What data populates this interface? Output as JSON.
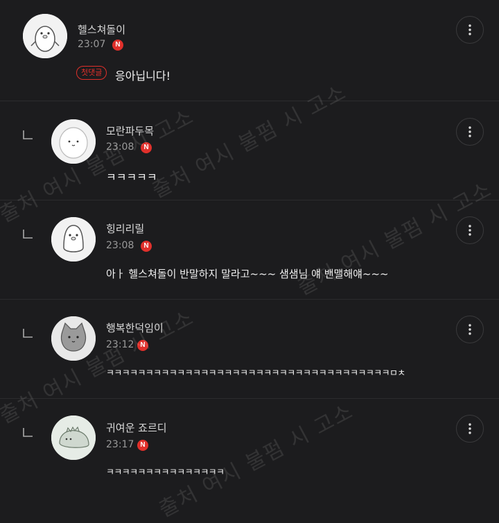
{
  "comments": [
    {
      "author": "헬스쳐돌이",
      "time": "23:07",
      "badge": "N",
      "first_comment_label": "첫댓글",
      "text": "응아닙니다!",
      "avatar_icon": "penguin-avatar-icon",
      "is_reply": false
    },
    {
      "author": "모란파두목",
      "time": "23:08",
      "badge": "N",
      "text": "ㅋㅋㅋㅋㅋ",
      "avatar_icon": "blob-avatar-icon",
      "is_reply": true
    },
    {
      "author": "힝리리릴",
      "time": "23:08",
      "badge": "N",
      "text": "아ㅏ 헬스쳐돌이 반말하지 말라고~~~ 샘샘님 얘 밴맬해얘~~~",
      "avatar_icon": "penguin-avatar-icon",
      "is_reply": true
    },
    {
      "author": "행복한덕임이",
      "time": "23:12",
      "badge": "N",
      "text": "ㅋㅋㅋㅋㅋㅋㅋㅋㅋㅋㅋㅋㅋㅋㅋㅋㅋㅋㅋㅋㅋㅋㅋㅋㅋㅋㅋㅋㅋㅋㅋㅋㅋㅋㅋㅋㅁㅊ",
      "avatar_icon": "cat-avatar-icon",
      "is_reply": true
    },
    {
      "author": "귀여운 죠르디",
      "time": "23:17",
      "badge": "N",
      "text": "ㅋㅋㅋㅋㅋㅋㅋㅋㅋㅋㅋㅋㅋㅋㅋ",
      "avatar_icon": "dinosaur-avatar-icon",
      "is_reply": true
    }
  ],
  "icons": {
    "more": "more-vertical-icon",
    "reply": "reply-arrow-icon"
  },
  "watermark_text": "출처 여시 불펌 시 고소",
  "colors": {
    "background": "#1c1c1e",
    "accent_red": "#e0302b",
    "text_primary": "#f0f0f0",
    "text_secondary": "#9a9a9a"
  }
}
